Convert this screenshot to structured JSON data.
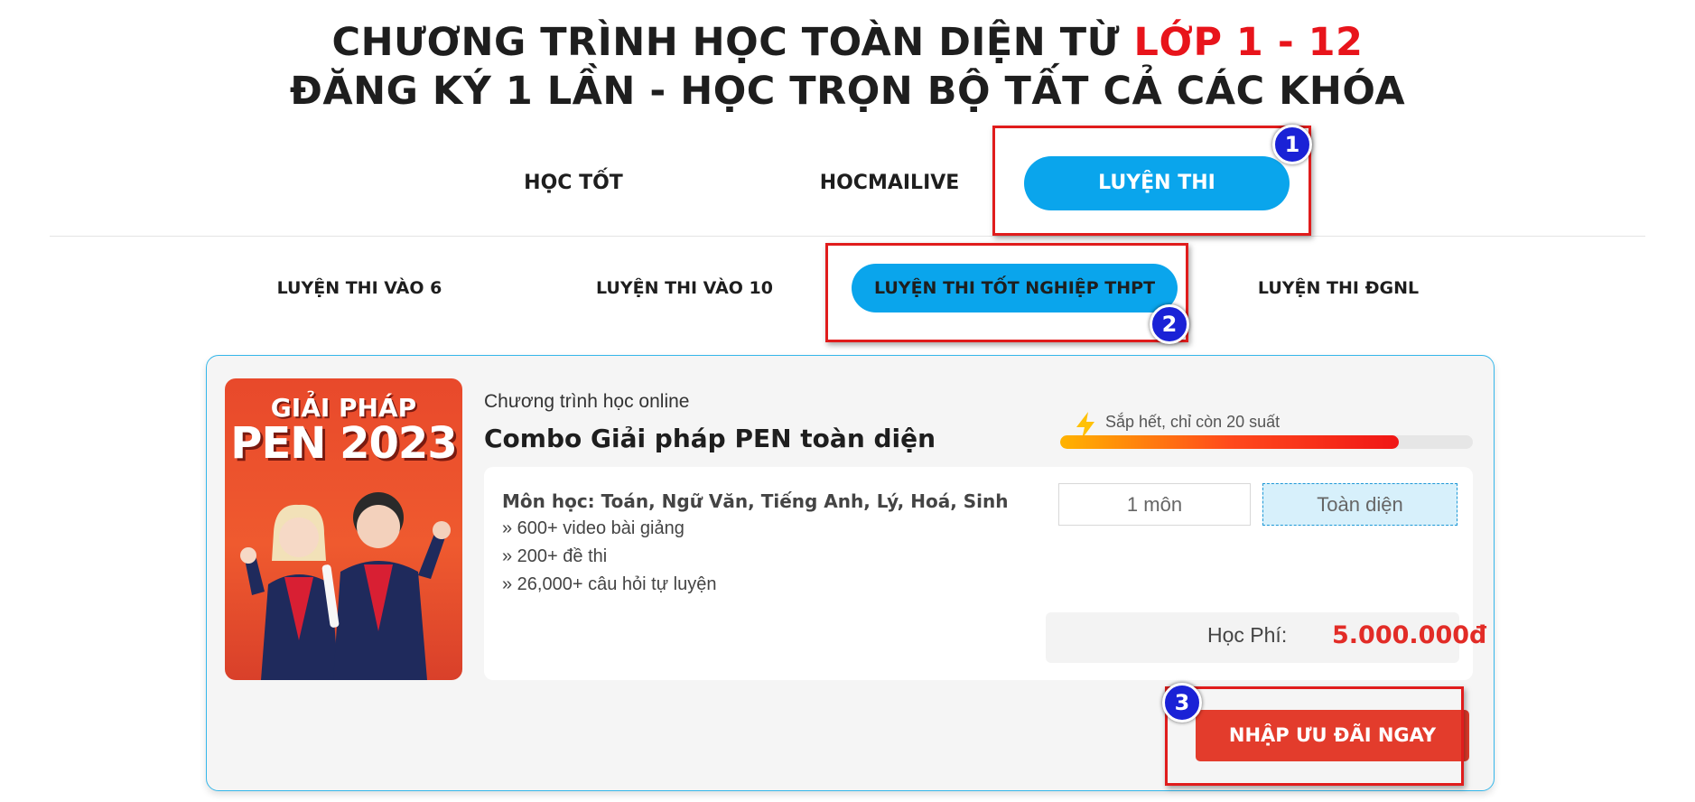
{
  "headline": {
    "line1_prefix": "CHƯƠNG TRÌNH HỌC TOÀN DIỆN TỪ ",
    "line1_highlight": "LỚP 1 - 12",
    "line2": "ĐĂNG KÝ 1 LẦN - HỌC TRỌN BỘ TẤT CẢ CÁC KHÓA"
  },
  "top_tabs": [
    {
      "label": "HỌC TỐT",
      "active": false
    },
    {
      "label": "HOCMAILIVE",
      "active": false
    },
    {
      "label": "LUYỆN THI",
      "active": true
    }
  ],
  "sub_tabs": [
    {
      "label": "LUYỆN THI VÀO 6",
      "active": false
    },
    {
      "label": "LUYỆN THI VÀO 10",
      "active": false
    },
    {
      "label": "LUYỆN THI TỐT NGHIỆP THPT",
      "active": true
    },
    {
      "label": "LUYỆN THI ĐGNL",
      "active": false
    }
  ],
  "annotations": [
    "1",
    "2",
    "3"
  ],
  "course": {
    "thumbnail_line1": "GIẢI PHÁP",
    "thumbnail_line2": "PEN 2023",
    "type": "Chương trình học online",
    "name": "Combo Giải pháp PEN toàn diện",
    "stock_text": "Sắp hết, chỉ còn 20 suất",
    "stock_fill_fraction": 0.82,
    "subjects": "Môn học: Toán, Ngữ Văn, Tiếng Anh, Lý, Hoá, Sinh",
    "features": [
      "» 600+ video bài giảng",
      "» 200+ đề thi",
      "» 26,000+ câu hỏi tự luyện"
    ],
    "options": [
      {
        "label": "1 môn",
        "selected": false
      },
      {
        "label": "Toàn diện",
        "selected": true
      }
    ],
    "fee_label": "Học Phí:",
    "fee_value": "5.000.000đ",
    "cta_label": "NHẬP ƯU ĐÃI NGAY"
  },
  "colors": {
    "accent_blue": "#0aa5ec",
    "highlight_red": "#e8141b",
    "price_red": "#e22c27",
    "cta_red": "#e33c2c",
    "annotation_red": "#e01c1c",
    "badge_blue": "#1a22d6"
  }
}
